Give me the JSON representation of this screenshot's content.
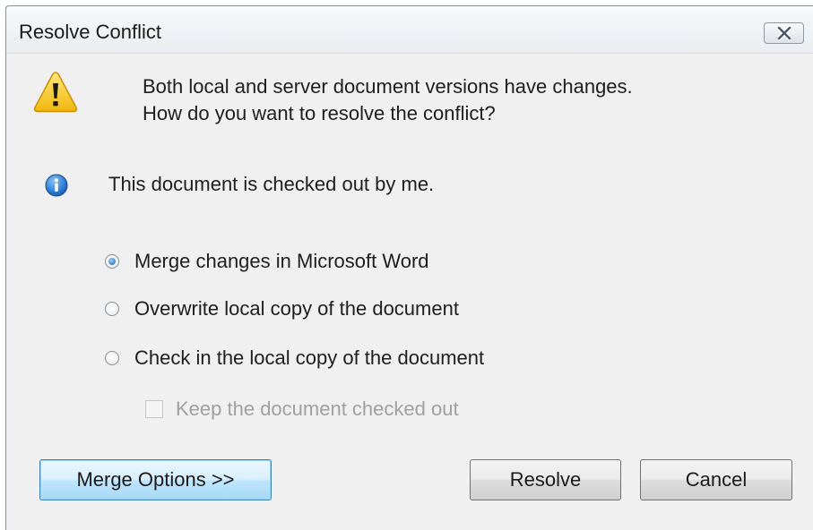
{
  "window": {
    "title": "Resolve Conflict"
  },
  "message": {
    "line1": "Both local and server document versions have changes.",
    "line2": "How do you want to resolve the conflict?"
  },
  "info": {
    "text": "This document is checked out by me."
  },
  "options": [
    {
      "label": "Merge changes in Microsoft Word",
      "selected": true
    },
    {
      "label": "Overwrite local copy of the document",
      "selected": false
    },
    {
      "label": "Check in the local copy of the document",
      "selected": false
    }
  ],
  "keep_checked_out": {
    "label": "Keep the document checked out",
    "checked": false,
    "enabled": false
  },
  "buttons": {
    "merge_options": "Merge Options >>",
    "resolve": "Resolve",
    "cancel": "Cancel"
  },
  "colors": {
    "dialog_background": "#f0f0f0",
    "accent_button_border": "#3c7fb1",
    "warning_yellow": "#f6c51c",
    "info_blue": "#1b67c4",
    "disabled_text": "#a0a0a0"
  },
  "icons": {
    "warning": "warning-icon",
    "info": "info-icon",
    "close": "close-icon"
  }
}
